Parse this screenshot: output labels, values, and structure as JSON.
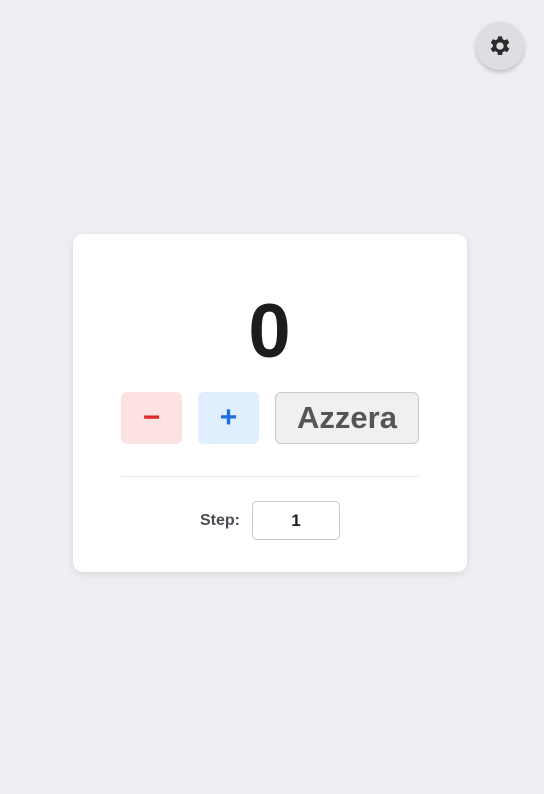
{
  "theme_toggle": {
    "icon": "gear-icon"
  },
  "counter": {
    "value": "0",
    "decrement_label": "−",
    "increment_label": "+",
    "reset_label": "Azzera"
  },
  "step": {
    "label": "Step:",
    "value": "1"
  },
  "colors": {
    "background": "#edeff3",
    "card": "#ffffff",
    "decrement_bg": "#fce2e2",
    "decrement_fg": "#e02a2a",
    "increment_bg": "#e0eefe",
    "increment_fg": "#1f6ee6",
    "reset_bg": "#f0f0f0",
    "reset_fg": "#555555"
  }
}
